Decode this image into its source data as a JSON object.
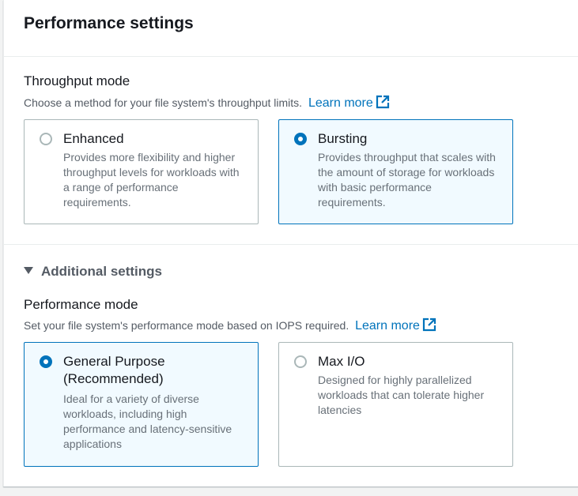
{
  "header": {
    "title": "Performance settings"
  },
  "throughput": {
    "title": "Throughput mode",
    "description": "Choose a method for your file system's throughput limits.",
    "learn_more": "Learn more",
    "options": [
      {
        "label": "Enhanced",
        "description": "Provides more flexibility and higher throughput levels for workloads with a range of performance requirements.",
        "selected": false
      },
      {
        "label": "Bursting",
        "description": "Provides throughput that scales with the amount of storage for workloads with basic performance requirements.",
        "selected": true
      }
    ]
  },
  "additional": {
    "toggle_label": "Additional settings",
    "expanded": true,
    "performance_mode": {
      "title": "Performance mode",
      "description": "Set your file system's performance mode based on IOPS required.",
      "learn_more": "Learn more",
      "options": [
        {
          "label": "General Purpose (Recommended)",
          "description": "Ideal for a variety of diverse workloads, including high performance and latency-sensitive applications",
          "selected": true
        },
        {
          "label": "Max I/O",
          "description": "Designed for highly parallelized workloads that can tolerate higher latencies",
          "selected": false
        }
      ]
    }
  },
  "colors": {
    "accent": "#0073bb",
    "selected_bg": "#f1faff",
    "border": "#aab7b8",
    "muted_text": "#687078"
  },
  "icons": {
    "external_link": "external-link-icon",
    "caret": "caret-down-icon"
  }
}
